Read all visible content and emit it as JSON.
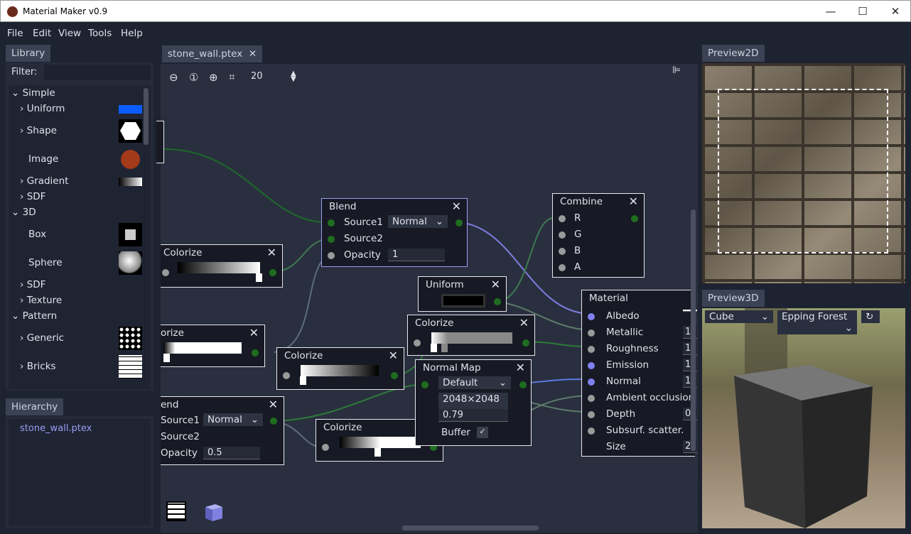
{
  "window": {
    "title": "Material Maker v0.9",
    "minimize": "—",
    "maximize": "☐",
    "close": "✕"
  },
  "menu": [
    "File",
    "Edit",
    "View",
    "Tools",
    "Help"
  ],
  "library": {
    "tab": "Library",
    "filter_label": "Filter:",
    "filter_value": "",
    "items": [
      {
        "label": "Simple",
        "arrow": "⌄"
      },
      {
        "label": "Uniform",
        "arrow": "›"
      },
      {
        "label": "Shape",
        "arrow": "›"
      },
      {
        "label": "Image",
        "arrow": ""
      },
      {
        "label": "Gradient",
        "arrow": "›"
      },
      {
        "label": "SDF",
        "arrow": "›"
      },
      {
        "label": "3D",
        "arrow": "⌄"
      },
      {
        "label": "Box",
        "arrow": ""
      },
      {
        "label": "Sphere",
        "arrow": ""
      },
      {
        "label": "SDF",
        "arrow": "›"
      },
      {
        "label": "Texture",
        "arrow": "›"
      },
      {
        "label": "Pattern",
        "arrow": "⌄"
      },
      {
        "label": "Generic",
        "arrow": "›"
      },
      {
        "label": "Bricks",
        "arrow": "›"
      }
    ]
  },
  "hierarchy": {
    "tab": "Hierarchy",
    "items": [
      "stone_wall.ptex"
    ]
  },
  "editor": {
    "tab": "stone_wall.ptex",
    "tab_close": "✕",
    "snap": "20"
  },
  "nodes": {
    "blend1": {
      "title": "Blend",
      "source1": "Source1",
      "mode": "Normal",
      "source2": "Source2",
      "opacity_label": "Opacity",
      "opacity": "1"
    },
    "blend2": {
      "title": "end",
      "source1": "Source1",
      "mode": "Normal",
      "source2": "Source2",
      "opacity_label": "Opacity",
      "opacity": "0.5"
    },
    "combine": {
      "title": "Combine",
      "ports": [
        "R",
        "G",
        "B",
        "A"
      ]
    },
    "uniform": {
      "title": "Uniform"
    },
    "colorize1": {
      "title": "Colorize"
    },
    "colorize2": {
      "title": "orize"
    },
    "colorize3": {
      "title": "Colorize"
    },
    "colorize4": {
      "title": "Colorize"
    },
    "colorize5": {
      "title": "Colorize"
    },
    "normalmap": {
      "title": "Normal Map",
      "mode": "Default",
      "size": "2048×2048",
      "amount": "0.79",
      "buffer": "Buffer"
    },
    "material": {
      "title": "Material",
      "ports": [
        "Albedo",
        "Metallic",
        "Roughness",
        "Emission",
        "Normal",
        "Ambient occlusion",
        "Depth",
        "Subsurf. scatter.",
        "Size"
      ],
      "values": [
        "",
        "1",
        "1",
        "1",
        "1",
        "",
        "0",
        "",
        "2"
      ]
    }
  },
  "preview2d": {
    "tab": "Preview2D"
  },
  "preview3d": {
    "tab": "Preview3D",
    "object": "Cube",
    "environment": "Epping Forest"
  },
  "colors": {
    "accent": "#8080f0",
    "port_green": "#1f6e1f",
    "background": "#1e2331"
  }
}
